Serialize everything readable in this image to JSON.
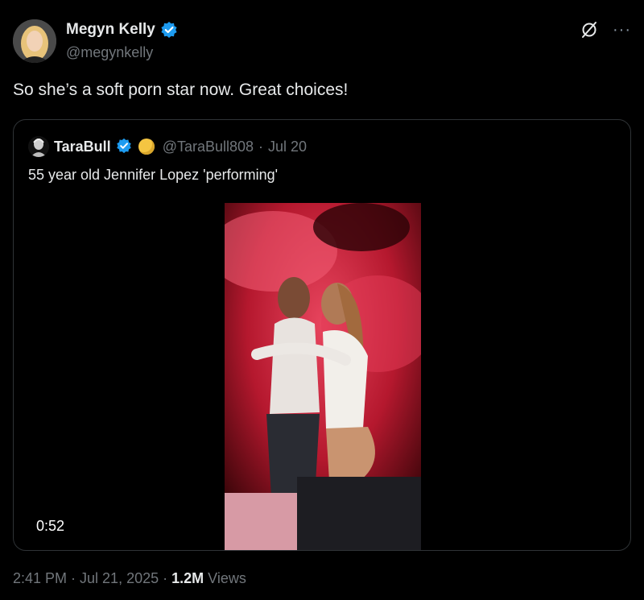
{
  "post": {
    "author_name": "Megyn Kelly",
    "author_handle": "@megynkelly",
    "text": "So she’s a soft porn star now. Great choices!",
    "timestamp": "2:41 PM · Jul 21, 2025 · ",
    "views_count": "1.2M",
    "views_label": " Views"
  },
  "quoted": {
    "author_name": "TaraBull",
    "author_handle": "@TaraBull808",
    "separator": "·",
    "date": "Jul 20",
    "text": "55 year old Jennifer Lopez 'performing'",
    "video_duration": "0:52"
  },
  "colors": {
    "background": "#000000",
    "text": "#e7e9ea",
    "muted": "#71767b",
    "verified": "#1d9bf0",
    "border": "#2f3336"
  },
  "icons": {
    "verified": "verified-badge-icon",
    "grok": "grok-icon",
    "more": "more-icon",
    "emoji": "yellow-circle-emoji-icon"
  }
}
